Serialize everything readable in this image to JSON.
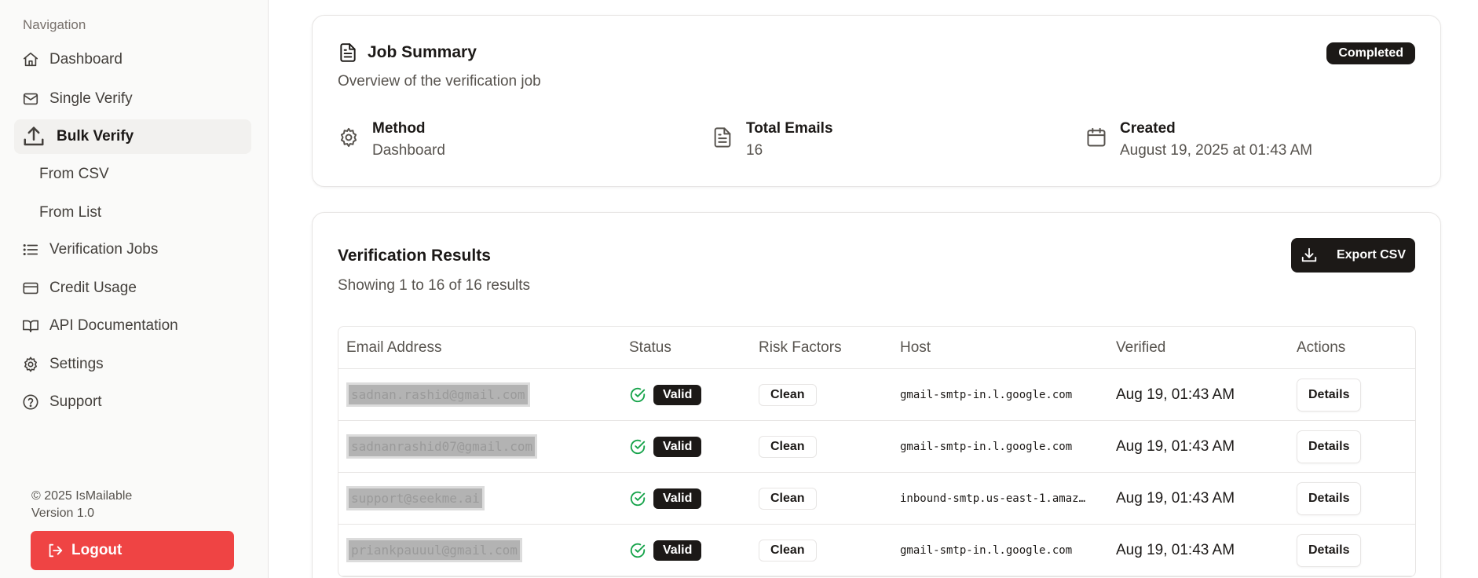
{
  "sidebar": {
    "heading": "Navigation",
    "items": [
      {
        "label": "Dashboard",
        "icon": "home-icon"
      },
      {
        "label": "Single Verify",
        "icon": "mail-icon"
      },
      {
        "label": "Bulk Verify",
        "icon": "upload-icon"
      },
      {
        "label": "Verification Jobs",
        "icon": "list-icon"
      },
      {
        "label": "Credit Usage",
        "icon": "credit-card-icon"
      },
      {
        "label": "API Documentation",
        "icon": "book-icon"
      },
      {
        "label": "Settings",
        "icon": "gear-icon"
      },
      {
        "label": "Support",
        "icon": "help-circle-icon"
      }
    ],
    "subitems": [
      "From CSV",
      "From List"
    ],
    "footer": {
      "copyright": "© 2025 IsMailable",
      "version": "Version 1.0"
    },
    "logout_label": "Logout"
  },
  "summary": {
    "title": "Job Summary",
    "subtitle": "Overview of the verification job",
    "status": "Completed",
    "method_label": "Method",
    "method_value": "Dashboard",
    "total_label": "Total Emails",
    "total_value": "16",
    "created_label": "Created",
    "created_value": "August 19, 2025 at 01:43 AM"
  },
  "results": {
    "title": "Verification Results",
    "subtitle": "Showing 1 to 16 of 16 results",
    "export_label": "Export CSV",
    "columns": [
      "Email Address",
      "Status",
      "Risk Factors",
      "Host",
      "Verified",
      "Actions"
    ],
    "rows": [
      {
        "email": "sadnan.rashid@gmail.com",
        "status": "Valid",
        "risk": "Clean",
        "host": "gmail-smtp-in.l.google.com",
        "verified": "Aug 19, 01:43 AM",
        "action": "Details"
      },
      {
        "email": "sadnanrashid07@gmail.com",
        "status": "Valid",
        "risk": "Clean",
        "host": "gmail-smtp-in.l.google.com",
        "verified": "Aug 19, 01:43 AM",
        "action": "Details"
      },
      {
        "email": "support@seekme.ai",
        "status": "Valid",
        "risk": "Clean",
        "host": "inbound-smtp.us-east-1.amaz…",
        "verified": "Aug 19, 01:43 AM",
        "action": "Details"
      },
      {
        "email": "priankpauuul@gmail.com",
        "status": "Valid",
        "risk": "Clean",
        "host": "gmail-smtp-in.l.google.com",
        "verified": "Aug 19, 01:43 AM",
        "action": "Details"
      }
    ]
  },
  "colors": {
    "accent": "#1c1917",
    "danger": "#ef4444",
    "success": "#16a34a"
  }
}
